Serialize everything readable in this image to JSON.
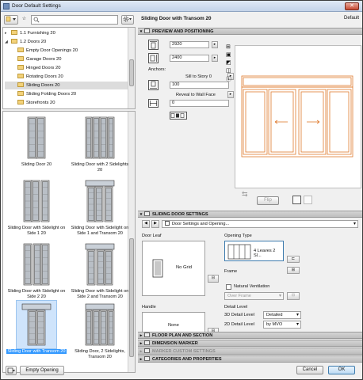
{
  "window": {
    "title": "Door Default Settings"
  },
  "left": {
    "tree": [
      {
        "label": "1.1 Furnishing 20",
        "level": 1,
        "expanded": false
      },
      {
        "label": "1.2 Doors 20",
        "level": 1,
        "expanded": true
      },
      {
        "label": "Empty Door Openings 20",
        "level": 2
      },
      {
        "label": "Garage Doors 20",
        "level": 2
      },
      {
        "label": "Hinged Doors 20",
        "level": 2
      },
      {
        "label": "Rotating Doors 20",
        "level": 2
      },
      {
        "label": "Sliding Doors 20",
        "level": 2,
        "selected": true
      },
      {
        "label": "Sliding Folding Doors 20",
        "level": 2
      },
      {
        "label": "Storefronts 20",
        "level": 2
      }
    ],
    "thumbnails": [
      {
        "caption": "Sliding Door 20",
        "variant": "sliding"
      },
      {
        "caption": "Sliding Door with 2 Sidelights 20",
        "variant": "sidelights2"
      },
      {
        "caption": "Sliding Door with Sidelight on Side 1 20",
        "variant": "side1"
      },
      {
        "caption": "Sliding Door with Sidelight on Side 1 and Transom 20",
        "variant": "side1transom"
      },
      {
        "caption": "Sliding Door with Sidelight on Side 2 20",
        "variant": "side2"
      },
      {
        "caption": "Sliding Door with Sidelight on Side 2 and Transom 20",
        "variant": "side2transom"
      },
      {
        "caption": "Sliding Door with Transom 20",
        "variant": "transom",
        "selected": true
      },
      {
        "caption": "Sliding Door, 2 Sidelights, Transom 20",
        "variant": "sidelights2transom"
      }
    ],
    "empty_opening_label": "Empty Opening"
  },
  "right": {
    "object_name": "Sliding Door with Transom 20",
    "default_label": "Default",
    "sections": {
      "preview": "PREVIEW AND POSITIONING",
      "sliding": "SLIDING DOOR SETTINGS",
      "floor_plan": "FLOOR PLAN AND SECTION",
      "dimension": "DIMENSION MARKER",
      "marker": "MARKER CUSTOM SETTINGS",
      "categories": "CATEGORIES AND PROPERTIES"
    },
    "width_value": "2920",
    "height_value": "2400",
    "anchors_label": "Anchors:",
    "sill_label": "Sill to Story 0",
    "sill_value": "100",
    "reveal_label": "Reveal to Wall Face",
    "reveal_value": "0",
    "flip_label": "Flip",
    "page_selector": "Door Settings and Opening...",
    "door_leaf_label": "Door Leaf",
    "door_leaf_value": "No Grid",
    "handle_label": "Handle",
    "handle_value": "None",
    "opening_type_label": "Opening Type",
    "opening_type_value": "4 Leaves 2 Sl...",
    "frame_label": "Frame",
    "natural_ventilation_label": "Natural Ventilation",
    "ventilation_option": "Over Frame",
    "detail_level_label": "Detail Level",
    "detail3d_label": "3D Detail Level",
    "detail3d_value": "Detailed",
    "detail2d_label": "2D Detail Level",
    "detail2d_value": "by MVO",
    "cancel_label": "Cancel",
    "ok_label": "OK"
  },
  "colors": {
    "door_outline": "#e07a2e",
    "selection": "#3399ff"
  }
}
